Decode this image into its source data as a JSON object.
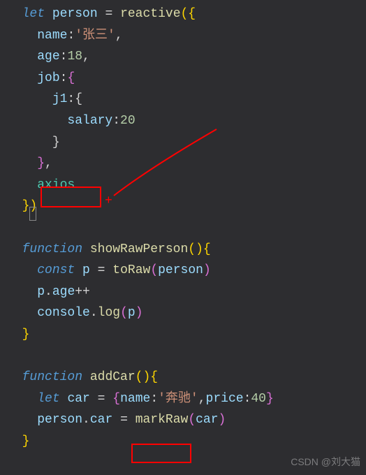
{
  "code": {
    "l1": {
      "kw": "let",
      "var": "person",
      "op": "=",
      "fn": "reactive",
      "open": "({"
    },
    "l2": {
      "prop": "name",
      "colon": ":",
      "str": "'张三'",
      "comma": ","
    },
    "l3": {
      "prop": "age",
      "colon": ":",
      "num": "18",
      "comma": ","
    },
    "l4": {
      "prop": "job",
      "colon": ":",
      "brace": "{"
    },
    "l5": {
      "prop": "j1",
      "colon": ":",
      "brace": "{"
    },
    "l6": {
      "prop": "salary",
      "colon": ":",
      "num": "20"
    },
    "l7": {
      "brace": "}"
    },
    "l8": {
      "brace": "}",
      "comma": ","
    },
    "l9": {
      "var": "axios"
    },
    "l10": {
      "close": "})"
    },
    "l12": {
      "kw": "function",
      "fn": "showRawPerson",
      "paren": "(){"
    },
    "l13": {
      "kw": "const",
      "var": "p",
      "op": "=",
      "fn": "toRaw",
      "arg": "person",
      "close": ")"
    },
    "l14": {
      "obj": "p",
      "dot": ".",
      "prop": "age",
      "op": "++"
    },
    "l15": {
      "obj": "console",
      "dot": ".",
      "fn": "log",
      "arg": "p",
      "close": ")"
    },
    "l16": {
      "brace": "}"
    },
    "l18": {
      "kw": "function",
      "fn": "addCar",
      "paren": "(){"
    },
    "l19": {
      "kw": "let",
      "var": "car",
      "op": "=",
      "open": "{",
      "p1": "name",
      "v1": "'奔驰'",
      "p2": "price",
      "v2": "40",
      "close": "}"
    },
    "l20": {
      "obj": "person",
      "dot": ".",
      "prop": "car",
      "op": "=",
      "fn": "markRaw",
      "arg": "car",
      "close": ")"
    },
    "l21": {
      "brace": "}"
    }
  },
  "watermark": "CSDN @刘大猫"
}
